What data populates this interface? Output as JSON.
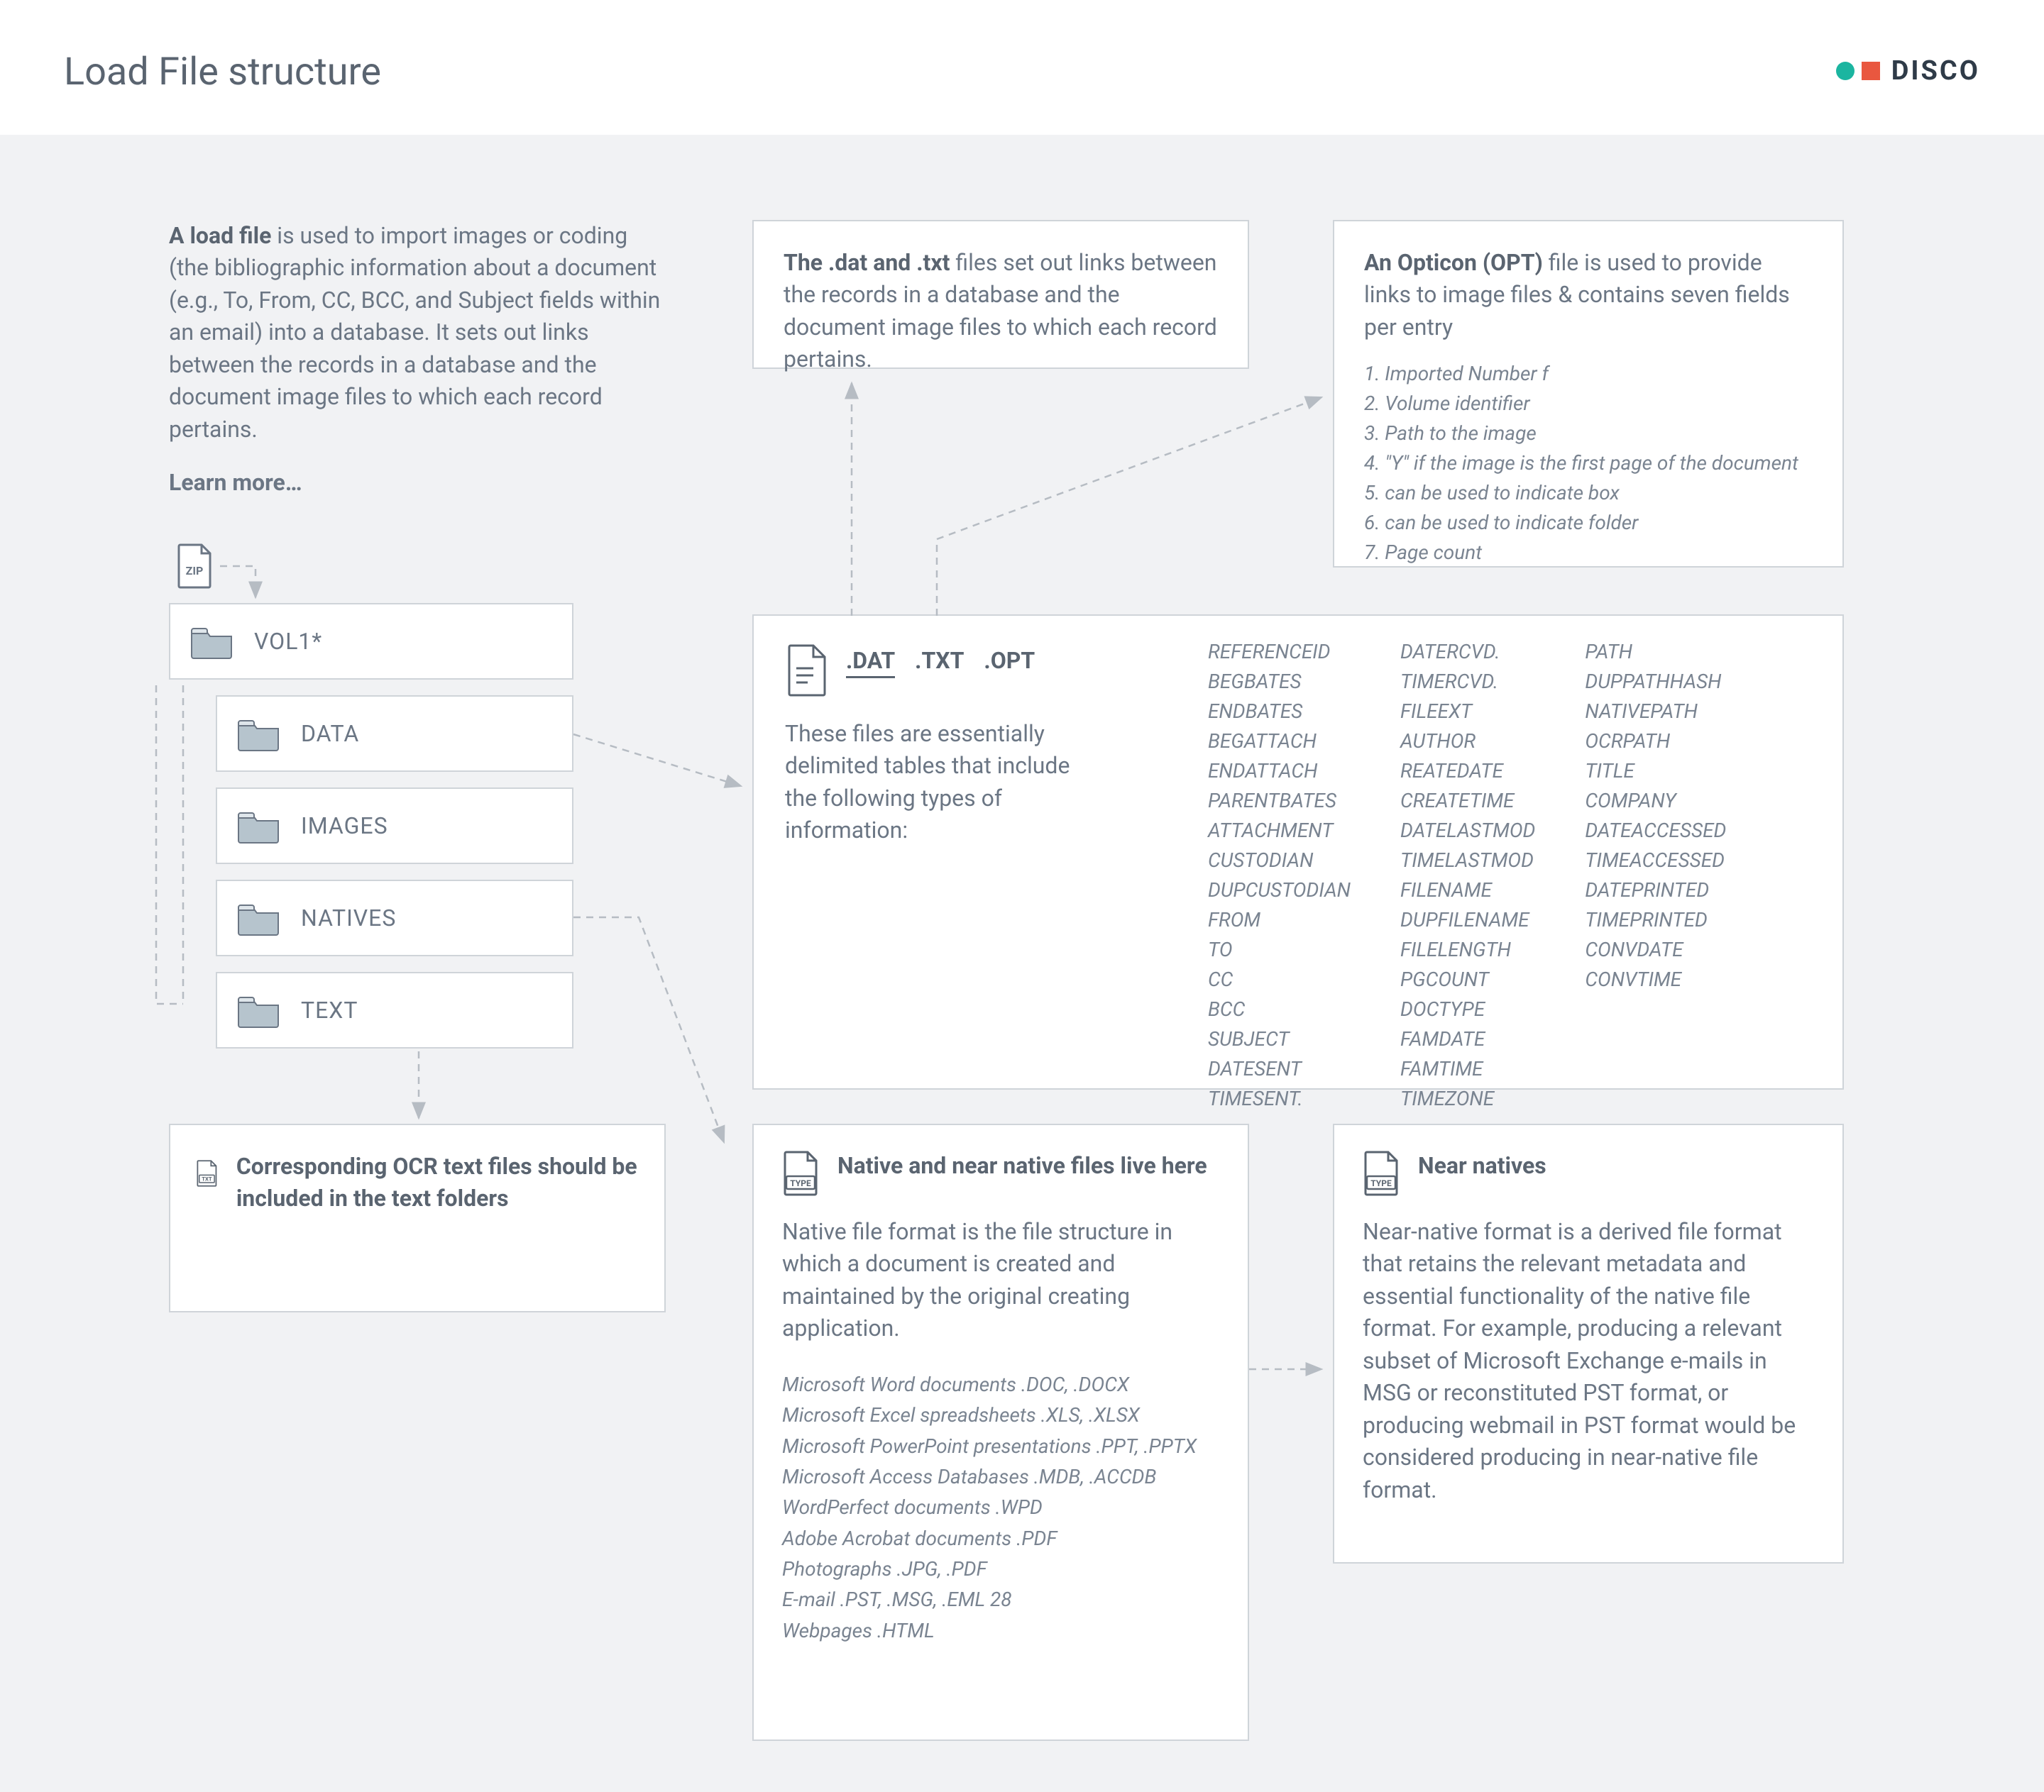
{
  "header": {
    "title": "Load File structure",
    "brand": "DISCO"
  },
  "intro": {
    "lead_bold": "A load file",
    "lead_rest": " is used to import images or coding (the bibliographic information about a document (e.g., To, From, CC, BCC, and Subject fields within an email) into a database. It sets out links between the records in a database and the document image files to which each record pertains.",
    "learn_more": "Learn more…"
  },
  "dat_explainer": {
    "bold": "The .dat and .txt",
    "rest": " files set out links between the records in a database and the document image files to which each record pertains."
  },
  "opticon": {
    "bold": "An Opticon (OPT)",
    "rest": " file is used to provide links to image files & contains seven fields per entry",
    "items": [
      "1. Imported Number f",
      "2. Volume identifier",
      "3. Path to the image",
      "4. \"Y\" if the image is the first page of the document",
      "5. can be used to indicate box",
      "6.  can be used to indicate folder",
      "7. Page count"
    ]
  },
  "tree": {
    "root": "VOL1*",
    "children": [
      "DATA",
      "IMAGES",
      "NATIVES",
      "TEXT"
    ]
  },
  "delim": {
    "tabs": [
      ".DAT",
      ".TXT",
      ".OPT"
    ],
    "active_tab_index": 0,
    "desc": "These files are essentially delimited tables that include the following types of information:",
    "field_columns": [
      [
        "REFERENCEID",
        "BEGBATES",
        "ENDBATES",
        "BEGATTACH",
        "ENDATTACH",
        "PARENTBATES",
        "ATTACHMENT",
        "CUSTODIAN",
        "DUPCUSTODIAN",
        "FROM",
        "TO",
        "CC",
        "BCC",
        "SUBJECT",
        "DATESENT",
        "TIMESENT."
      ],
      [
        "DATERCVD.",
        "TIMERCVD.",
        "FILEEXT",
        "AUTHOR",
        "REATEDATE",
        "CREATETIME",
        "DATELASTMOD",
        "TIMELASTMOD",
        "FILENAME",
        "DUPFILENAME",
        "FILELENGTH",
        "PGCOUNT",
        "DOCTYPE",
        "FAMDATE",
        "FAMTIME",
        "TIMEZONE"
      ],
      [
        "PATH",
        "DUPPATHHASH",
        "NATIVEPATH",
        "OCRPATH",
        "TITLE",
        "COMPANY",
        "DATEACCESSED",
        "TIMEACCESSED",
        "DATEPRINTED",
        "TIMEPRINTED",
        "CONVDATE",
        "CONVTIME"
      ]
    ]
  },
  "ocr": {
    "text": "Corresponding OCR text files should be included in the text folders"
  },
  "native": {
    "heading": "Native and near native files live here",
    "desc": "Native file format is the file structure in which a document is created and maintained by the original creating application.",
    "list": [
      "Microsoft Word documents .DOC, .DOCX",
      "Microsoft Excel spreadsheets .XLS, .XLSX",
      "Microsoft PowerPoint presentations .PPT, .PPTX",
      "Microsoft Access Databases .MDB, .ACCDB",
      "WordPerfect documents .WPD",
      "Adobe Acrobat documents .PDF",
      "Photographs .JPG, .PDF",
      "E-mail .PST, .MSG, .EML 28",
      "Webpages .HTML"
    ]
  },
  "nearnative": {
    "heading": "Near natives",
    "desc": "Near-native format is a derived file format that retains the relevant metadata and essential functionality of the native file format. For example, producing a relevant subset of Microsoft Exchange e-mails in MSG or reconstituted PST format, or producing webmail in PST format would be considered producing in near-native file format."
  },
  "icons": {
    "zip_label": "ZIP",
    "txt_label": "TXT",
    "type_label": "TYPE"
  }
}
